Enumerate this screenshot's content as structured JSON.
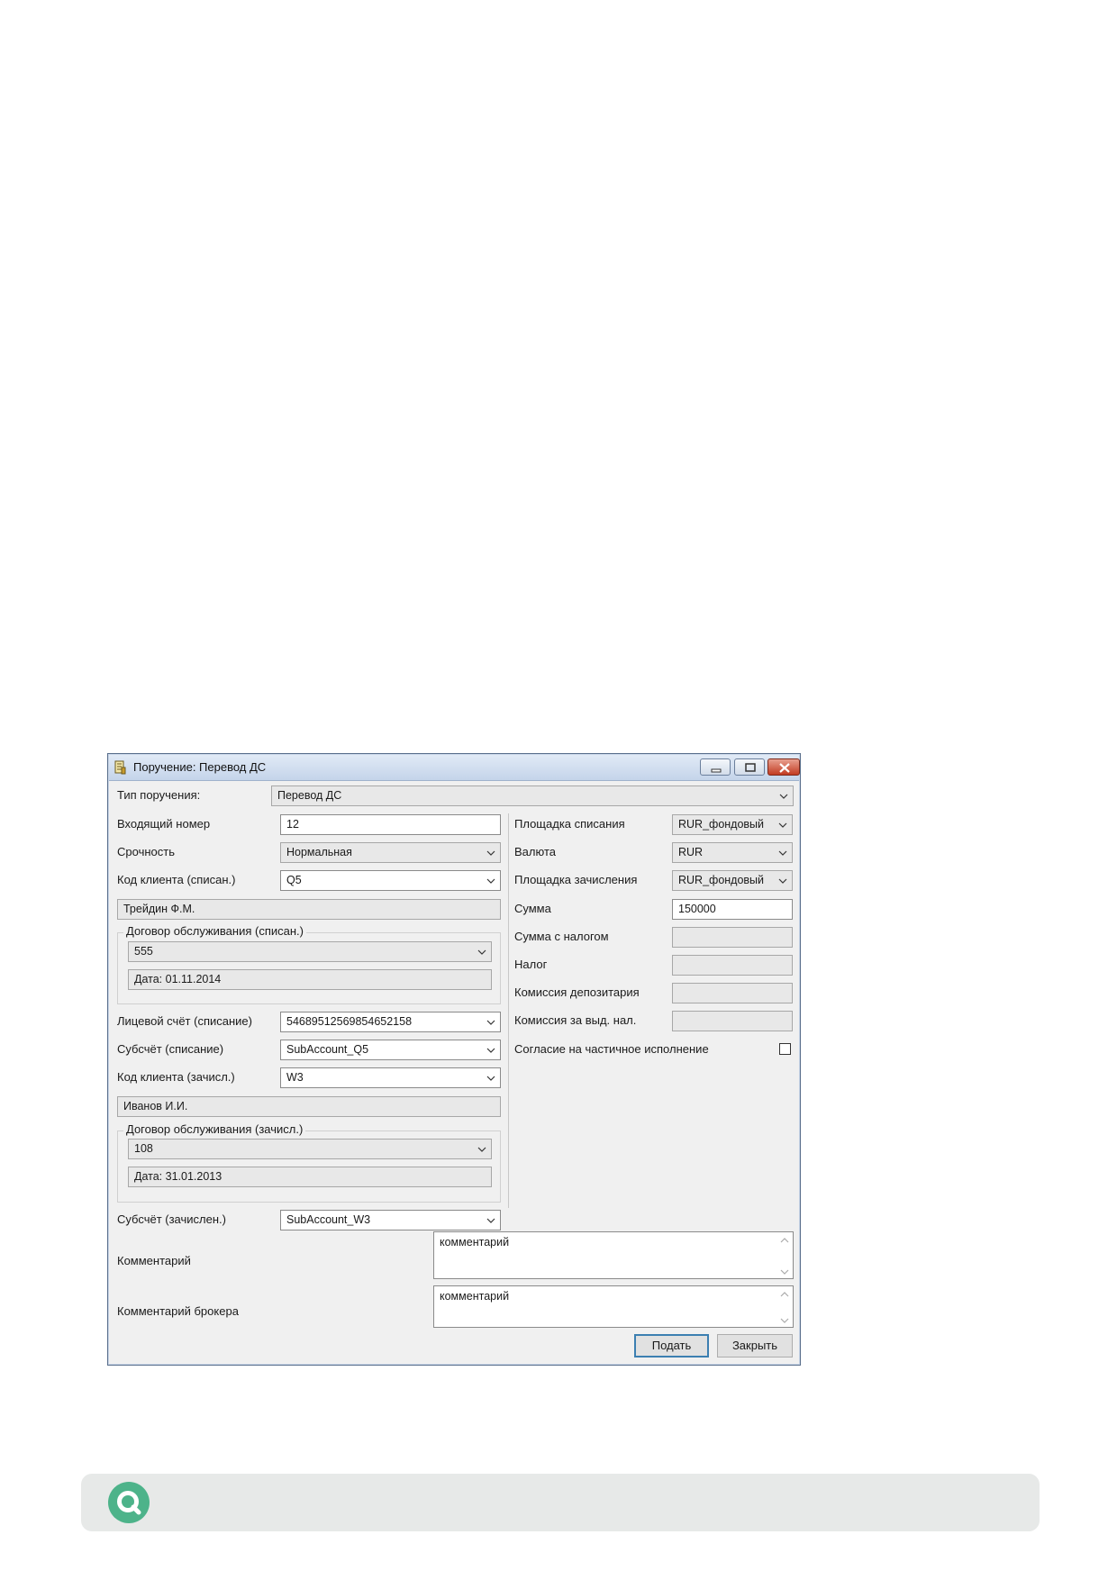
{
  "window": {
    "title": "Поручение: Перевод ДС"
  },
  "form": {
    "order_type": {
      "label": "Тип поручения:",
      "value": "Перевод ДС"
    },
    "incoming_number": {
      "label": "Входящий номер",
      "value": "12"
    },
    "urgency": {
      "label": "Срочность",
      "value": "Нормальная"
    },
    "client_code_debit": {
      "label": "Код клиента (списан.)",
      "value": "Q5"
    },
    "client_name_debit": {
      "value": "Трейдин Ф.М."
    },
    "contract_debit": {
      "title": "Договор обслуживания (списан.)",
      "value": "555",
      "date": "Дата: 01.11.2014"
    },
    "account_debit": {
      "label": "Лицевой счёт (списание)",
      "value": "54689512569854652158"
    },
    "subaccount_debit": {
      "label": "Субсчёт (списание)",
      "value": "SubAccount_Q5"
    },
    "client_code_credit": {
      "label": "Код клиента (зачисл.)",
      "value": "W3"
    },
    "client_name_credit": {
      "value": "Иванов И.И."
    },
    "contract_credit": {
      "title": "Договор обслуживания (зачисл.)",
      "value": "108",
      "date": "Дата: 31.01.2013"
    },
    "subaccount_credit": {
      "label": "Субсчёт (зачислен.)",
      "value": "SubAccount_W3"
    },
    "debit_platform": {
      "label": "Площадка списания",
      "value": "RUR_фондовый"
    },
    "currency": {
      "label": "Валюта",
      "value": "RUR"
    },
    "credit_platform": {
      "label": "Площадка зачисления",
      "value": "RUR_фондовый"
    },
    "amount": {
      "label": "Сумма",
      "value": "150000"
    },
    "amount_with_tax": {
      "label": "Сумма с налогом",
      "value": ""
    },
    "tax": {
      "label": "Налог",
      "value": ""
    },
    "depository_fee": {
      "label": "Комиссия депозитария",
      "value": ""
    },
    "tax_fee": {
      "label": "Комиссия за выд. нал.",
      "value": ""
    },
    "partial_execution": {
      "label": "Согласие на частичное исполнение",
      "checked": false
    },
    "comment": {
      "label": "Комментарий",
      "value": "комментарий"
    },
    "broker_comment": {
      "label": "Комментарий брокера",
      "value": "комментарий"
    }
  },
  "buttons": {
    "submit": "Подать",
    "close": "Закрыть"
  },
  "colors": {
    "footer_bg": "#e7e9e8",
    "logo_green": "#4db38a"
  }
}
